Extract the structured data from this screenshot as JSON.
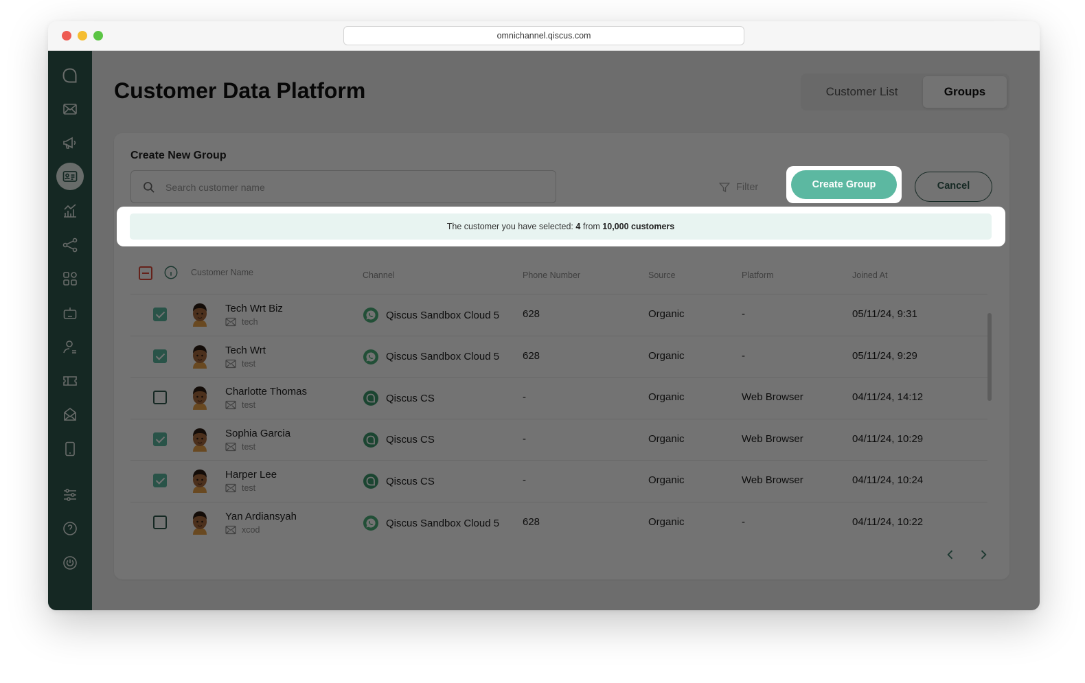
{
  "browser": {
    "url": "omnichannel.qiscus.com"
  },
  "header": {
    "title": "Customer Data Platform",
    "tabs": [
      {
        "label": "Customer List",
        "active": false
      },
      {
        "label": "Groups",
        "active": true
      }
    ]
  },
  "sidebar": {
    "items": [
      {
        "icon": "chat-logo-icon",
        "active": false
      },
      {
        "icon": "mail-icon",
        "active": false
      },
      {
        "icon": "megaphone-icon",
        "active": false
      },
      {
        "icon": "contact-card-icon",
        "active": true
      },
      {
        "icon": "analytics-icon",
        "active": false
      },
      {
        "icon": "share-nodes-icon",
        "active": false
      },
      {
        "icon": "apps-grid-icon",
        "active": false
      },
      {
        "icon": "robot-icon",
        "active": false
      },
      {
        "icon": "agent-icon",
        "active": false
      },
      {
        "icon": "ticket-icon",
        "active": false
      },
      {
        "icon": "inbox-icon",
        "active": false
      },
      {
        "icon": "mobile-icon",
        "active": false
      },
      {
        "icon": "settings-sliders-icon",
        "active": false
      },
      {
        "icon": "help-icon",
        "active": false
      },
      {
        "icon": "power-icon",
        "active": false
      }
    ]
  },
  "group": {
    "title": "Create New Group",
    "search_placeholder": "Search customer name",
    "filter_label": "Filter",
    "create_label": "Create Group",
    "cancel_label": "Cancel",
    "notice_prefix": "The customer you have selected:",
    "selected_count": "4",
    "notice_mid": "from",
    "notice_total": "10,000 customers"
  },
  "table": {
    "columns": [
      "Customer Name",
      "Channel",
      "Phone Number",
      "Source",
      "Platform",
      "Joined At"
    ],
    "rows": [
      {
        "checked": true,
        "name": "Tech Wrt Biz",
        "email": "tech",
        "channel": "Qiscus Sandbox Cloud 5",
        "channel_type": "whatsapp",
        "phone": "628",
        "source": "Organic",
        "platform": "-",
        "joined": "05/11/24, 9:31"
      },
      {
        "checked": true,
        "name": "Tech Wrt",
        "email": "test",
        "channel": "Qiscus Sandbox Cloud 5",
        "channel_type": "whatsapp",
        "phone": "628",
        "source": "Organic",
        "platform": "-",
        "joined": "05/11/24, 9:29"
      },
      {
        "checked": false,
        "name": "Charlotte Thomas",
        "email": "test",
        "channel": "Qiscus CS",
        "channel_type": "qiscus",
        "phone": "-",
        "source": "Organic",
        "platform": "Web Browser",
        "joined": "04/11/24, 14:12"
      },
      {
        "checked": true,
        "name": "Sophia Garcia",
        "email": "test",
        "channel": "Qiscus CS",
        "channel_type": "qiscus",
        "phone": "-",
        "source": "Organic",
        "platform": "Web Browser",
        "joined": "04/11/24, 10:29"
      },
      {
        "checked": true,
        "name": "Harper Lee",
        "email": "test",
        "channel": "Qiscus CS",
        "channel_type": "qiscus",
        "phone": "-",
        "source": "Organic",
        "platform": "Web Browser",
        "joined": "04/11/24, 10:24"
      },
      {
        "checked": false,
        "name": "Yan Ardiansyah",
        "email": "xcod",
        "channel": "Qiscus Sandbox Cloud 5",
        "channel_type": "whatsapp",
        "phone": "628",
        "source": "Organic",
        "platform": "-",
        "joined": "04/11/24, 10:22"
      }
    ]
  },
  "colors": {
    "sidebar": "#2f5a4e",
    "accent": "#5cb8a1",
    "notice_bg": "#e8f4f1",
    "danger": "#e04b3a"
  }
}
